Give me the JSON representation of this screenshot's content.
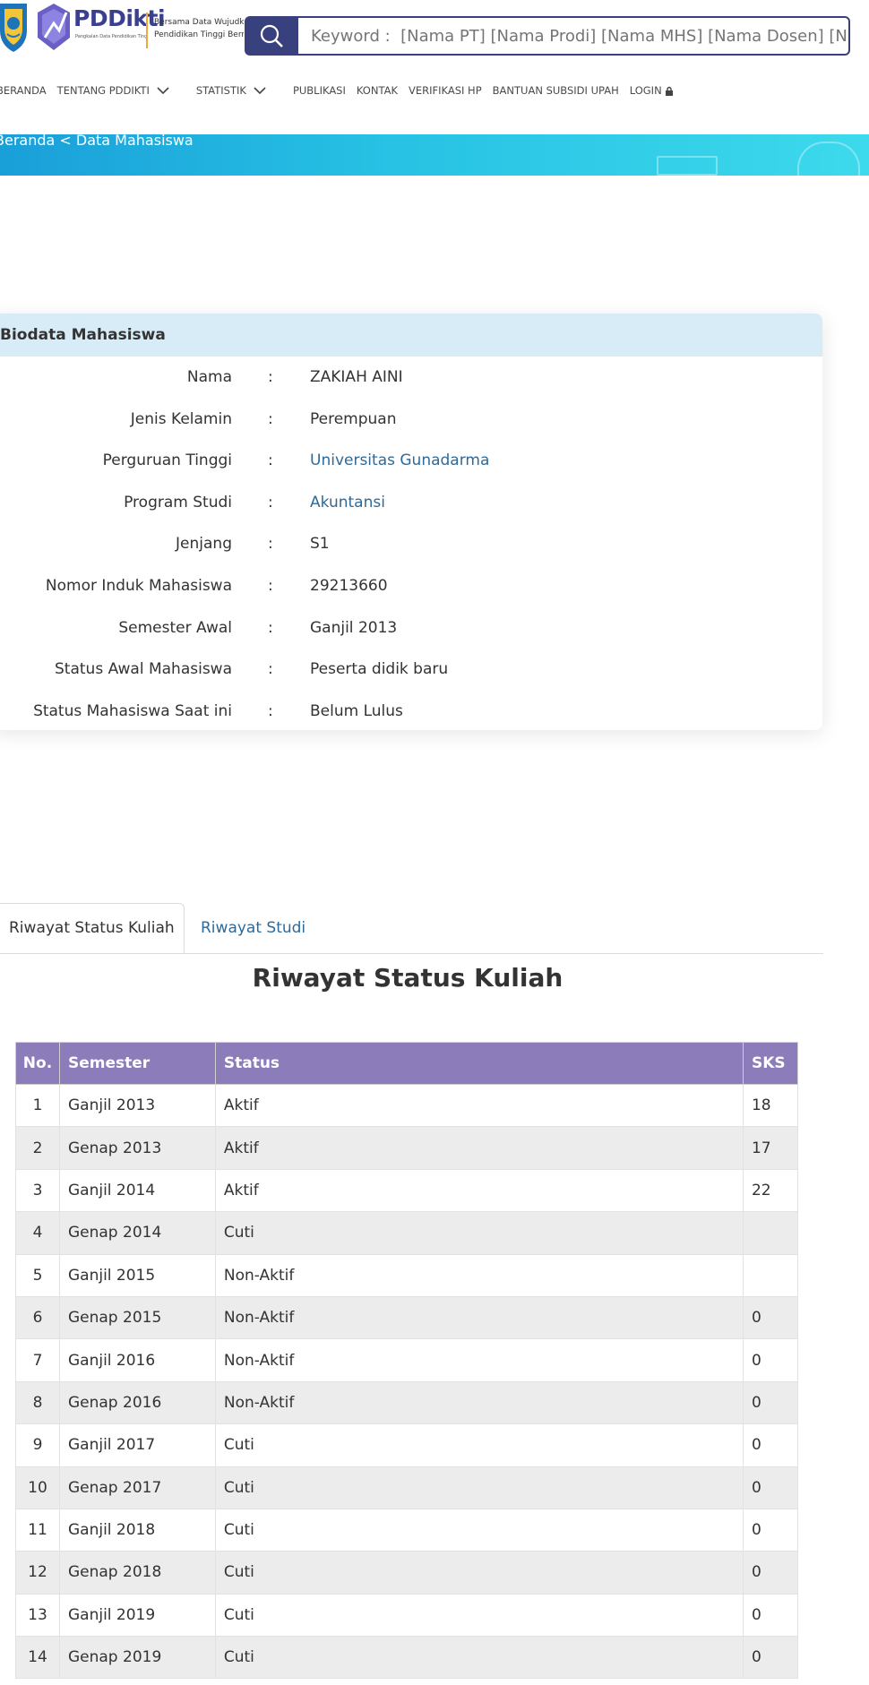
{
  "header": {
    "logo_text": "PDDikti",
    "logo_subtext": "Pangkalan Data Pendidikan Tinggi",
    "tagline_line1": "Bersama Data Wujudkan",
    "tagline_line2": "Pendidikan Tinggi Bermutu",
    "search_placeholder": "Keyword :  [Nama PT] [Nama Prodi] [Nama MHS] [Nama Dosen] [NIM] [NIDN]"
  },
  "nav": {
    "items": [
      "BERANDA",
      "TENTANG PDDIKTI",
      "STATISTIK",
      "PUBLIKASI",
      "KONTAK",
      "VERIFIKASI HP",
      "BANTUAN SUBSIDI UPAH",
      "LOGIN"
    ]
  },
  "breadcrumb": "Beranda < Data Mahasiswa",
  "biodata": {
    "title": "Biodata Mahasiswa",
    "rows": [
      {
        "label": "Nama",
        "value": "ZAKIAH AINI"
      },
      {
        "label": "Jenis Kelamin",
        "value": "Perempuan"
      },
      {
        "label": "Perguruan Tinggi",
        "value": "Universitas Gunadarma"
      },
      {
        "label": "Program Studi",
        "value": "Akuntansi"
      },
      {
        "label": "Jenjang",
        "value": "S1"
      },
      {
        "label": "Nomor Induk Mahasiswa",
        "value": "29213660"
      },
      {
        "label": "Semester Awal",
        "value": "Ganjil 2013"
      },
      {
        "label": "Status Awal Mahasiswa",
        "value": "Peserta didik baru"
      },
      {
        "label": "Status Mahasiswa Saat ini",
        "value": "Belum Lulus"
      }
    ],
    "colon": ":"
  },
  "tabs": {
    "active": "Riwayat Status Kuliah",
    "inactive": "Riwayat Studi"
  },
  "section_title": "Riwayat Status Kuliah",
  "table": {
    "headers": [
      "No.",
      "Semester",
      "Status",
      "SKS"
    ],
    "rows": [
      [
        "1",
        "Ganjil 2013",
        "Aktif",
        "18"
      ],
      [
        "2",
        "Genap 2013",
        "Aktif",
        "17"
      ],
      [
        "3",
        "Ganjil 2014",
        "Aktif",
        "22"
      ],
      [
        "4",
        "Genap 2014",
        "Cuti",
        ""
      ],
      [
        "5",
        "Ganjil 2015",
        "Non-Aktif",
        ""
      ],
      [
        "6",
        "Genap 2015",
        "Non-Aktif",
        "0"
      ],
      [
        "7",
        "Ganjil 2016",
        "Non-Aktif",
        "0"
      ],
      [
        "8",
        "Genap 2016",
        "Non-Aktif",
        "0"
      ],
      [
        "9",
        "Ganjil 2017",
        "Cuti",
        "0"
      ],
      [
        "10",
        "Genap 2017",
        "Cuti",
        "0"
      ],
      [
        "11",
        "Ganjil 2018",
        "Cuti",
        "0"
      ],
      [
        "12",
        "Genap 2018",
        "Cuti",
        "0"
      ],
      [
        "13",
        "Ganjil 2019",
        "Cuti",
        "0"
      ],
      [
        "14",
        "Genap 2019",
        "Cuti",
        "0"
      ]
    ]
  },
  "colors": {
    "brand_navy": "#39407e",
    "banner_start": "#1a9fd9",
    "banner_end": "#3dd9ec",
    "card_header": "#d8ecf7",
    "table_header": "#8c7cba",
    "link": "#2d6a9a"
  },
  "icons": [
    "emblem-logo-icon",
    "pddikti-logo-icon",
    "search-icon",
    "chevron-down-icon",
    "lock-icon"
  ]
}
